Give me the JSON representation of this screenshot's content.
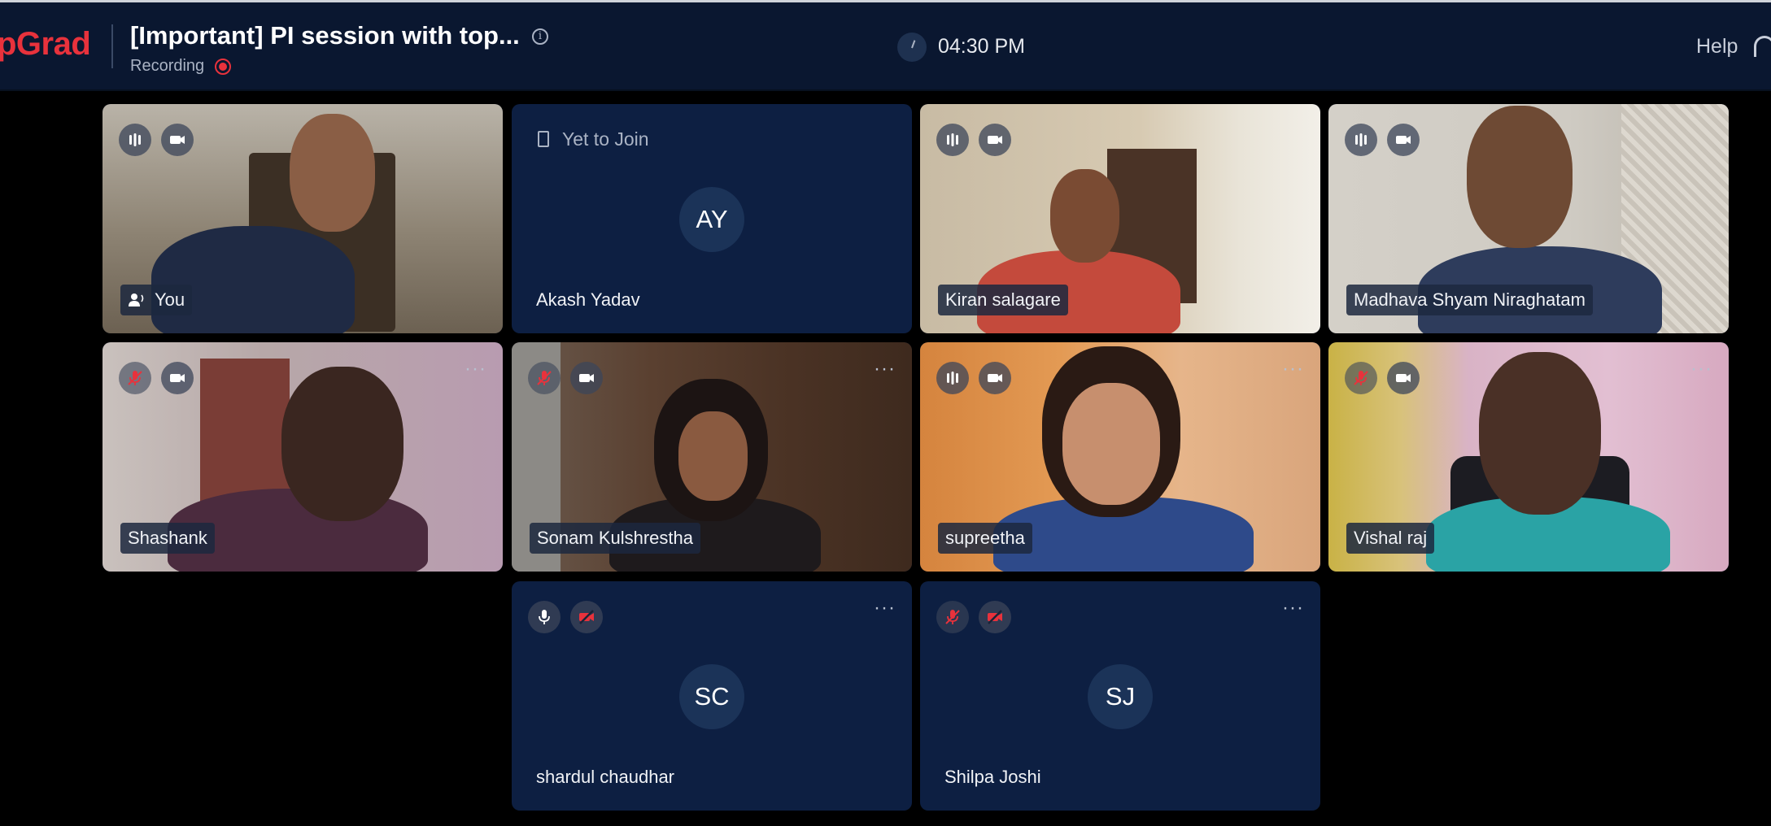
{
  "header": {
    "logo_text": "pGrad",
    "title": "[Important] PI session with top...",
    "recording_label": "Recording",
    "time": "04:30 PM",
    "help_label": "Help"
  },
  "participants": [
    {
      "name": "You",
      "video": "on"
    },
    {
      "name": "Akash Yadav",
      "initials": "AY",
      "status": "Yet to Join"
    },
    {
      "name": "Kiran salagare",
      "video": "on"
    },
    {
      "name": "Madhava Shyam Niraghatam",
      "video": "on"
    },
    {
      "name": "Shashank",
      "video": "on",
      "mic": "muted"
    },
    {
      "name": "Sonam Kulshrestha",
      "video": "on",
      "mic": "muted"
    },
    {
      "name": "supreetha",
      "video": "on"
    },
    {
      "name": "Vishal raj",
      "video": "on",
      "mic": "muted"
    },
    {
      "name": "shardul chaudhar",
      "initials": "SC",
      "video": "off"
    },
    {
      "name": "Shilpa Joshi",
      "initials": "SJ",
      "video": "off",
      "mic": "muted"
    }
  ],
  "colors": {
    "brand": "#e8323c",
    "topbar": "#0a1730",
    "tile_empty": "#0d1f42",
    "avatar": "#1b3358"
  },
  "icons": {
    "more": "···",
    "info": "i"
  }
}
